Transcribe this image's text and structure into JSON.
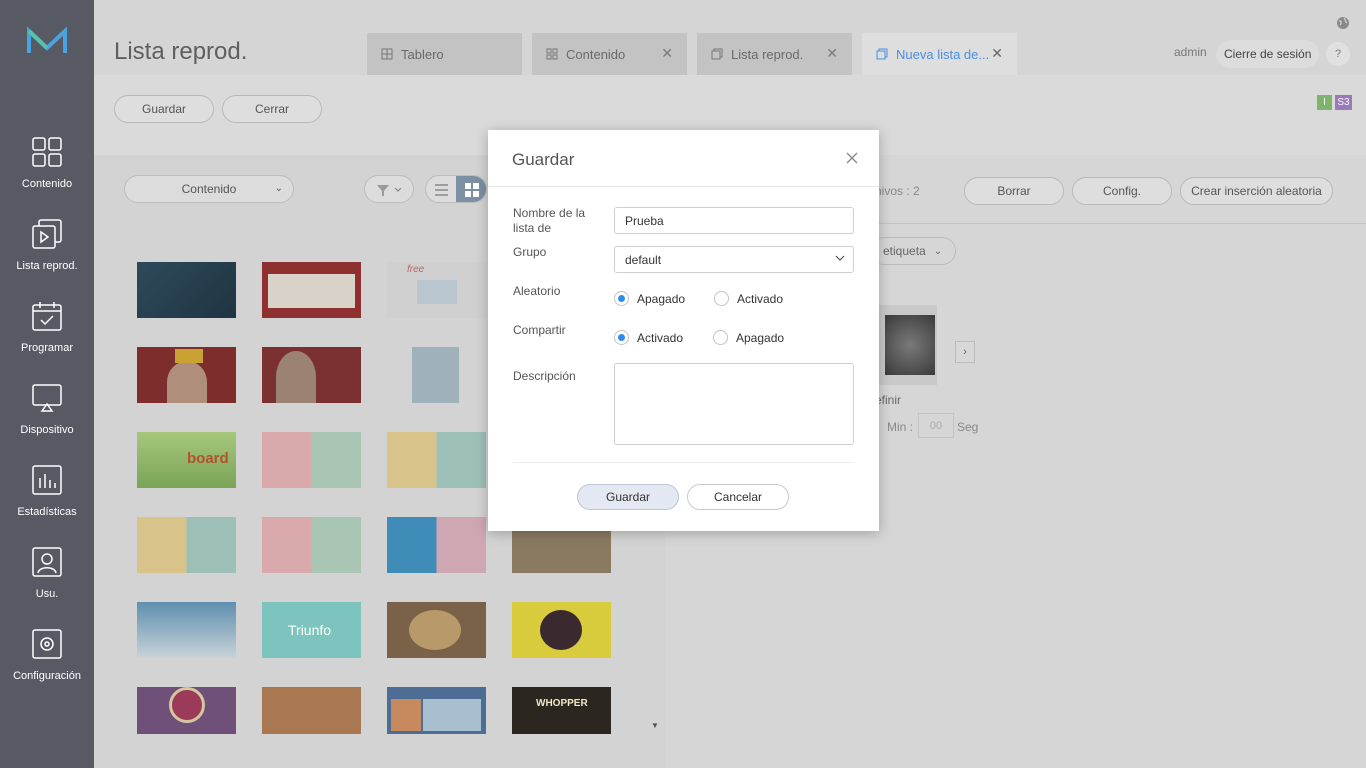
{
  "sidebar": {
    "items": [
      {
        "label": "Contenido",
        "icon": "grid-icon"
      },
      {
        "label": "Lista reprod.",
        "icon": "playlist-icon"
      },
      {
        "label": "Programar",
        "icon": "calendar-icon"
      },
      {
        "label": "Dispositivo",
        "icon": "monitor-icon"
      },
      {
        "label": "Estadísticas",
        "icon": "bar-chart-icon"
      },
      {
        "label": "Usu.",
        "icon": "user-icon"
      },
      {
        "label": "Configuración",
        "icon": "gear-icon"
      }
    ]
  },
  "header": {
    "title": "Lista reprod.",
    "tabs": [
      {
        "label": "Tablero",
        "closable": false
      },
      {
        "label": "Contenido",
        "closable": true
      },
      {
        "label": "Lista reprod.",
        "closable": true
      },
      {
        "label": "Nueva lista de...",
        "closable": true,
        "active": true
      }
    ],
    "user": "admin",
    "logout_label": "Cierre de sesión",
    "help_label": "?"
  },
  "toolbar": {
    "save_label": "Guardar",
    "close_label": "Cerrar",
    "badge_i": "I",
    "badge_s3": "S3"
  },
  "left_panel": {
    "content_select": "Contenido"
  },
  "right_panel": {
    "files_count": "hivos : 2",
    "delete_label": "Borrar",
    "config_label": "Config.",
    "random_insert_label": "Crear inserción aleatoria",
    "tag_filter": "etiqueta",
    "item_label": "efinir",
    "min_label": "Min :",
    "min_value": "00",
    "seg_label": "Seg"
  },
  "modal": {
    "title": "Guardar",
    "name_label": "Nombre de la lista de",
    "name_value": "Prueba",
    "group_label": "Grupo",
    "group_value": "default",
    "random_label": "Aleatorio",
    "random_off": "Apagado",
    "random_on": "Activado",
    "share_label": "Compartir",
    "share_on": "Activado",
    "share_off": "Apagado",
    "description_label": "Descripción",
    "save_button": "Guardar",
    "cancel_button": "Cancelar"
  },
  "thumbnail_text": {
    "board": "board",
    "triunfo": "Triunfo",
    "whopper": "WHOPPER",
    "free": "free"
  },
  "colors": {
    "sidebar": "#575a63",
    "accent": "#4a90e2",
    "radio_on": "#2d8cf0"
  }
}
